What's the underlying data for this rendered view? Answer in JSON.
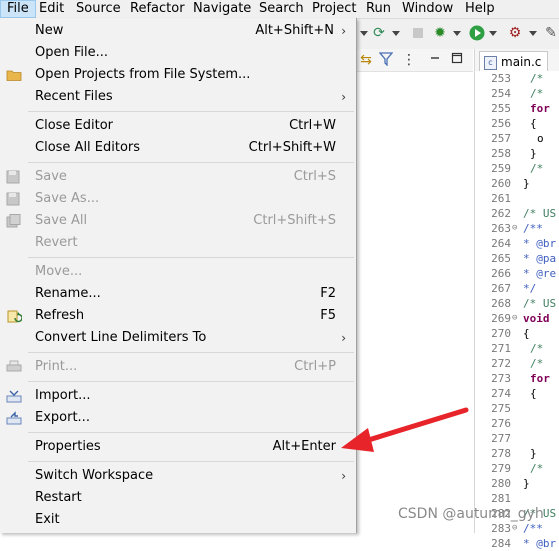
{
  "menubar": {
    "items": [
      "File",
      "Edit",
      "Source",
      "Refactor",
      "Navigate",
      "Search",
      "Project",
      "Run",
      "Window",
      "Help"
    ]
  },
  "file_menu": {
    "new": {
      "label": "New",
      "accel": "Alt+Shift+N"
    },
    "open_file": {
      "label": "Open File..."
    },
    "open_projects": {
      "label": "Open Projects from File System..."
    },
    "recent_files": {
      "label": "Recent Files"
    },
    "close_editor": {
      "label": "Close Editor",
      "accel": "Ctrl+W"
    },
    "close_all": {
      "label": "Close All Editors",
      "accel": "Ctrl+Shift+W"
    },
    "save": {
      "label": "Save",
      "accel": "Ctrl+S"
    },
    "save_as": {
      "label": "Save As..."
    },
    "save_all": {
      "label": "Save All",
      "accel": "Ctrl+Shift+S"
    },
    "revert": {
      "label": "Revert"
    },
    "move": {
      "label": "Move..."
    },
    "rename": {
      "label": "Rename...",
      "accel": "F2"
    },
    "refresh": {
      "label": "Refresh",
      "accel": "F5"
    },
    "convert": {
      "label": "Convert Line Delimiters To"
    },
    "print": {
      "label": "Print...",
      "accel": "Ctrl+P"
    },
    "import": {
      "label": "Import..."
    },
    "export": {
      "label": "Export..."
    },
    "properties": {
      "label": "Properties",
      "accel": "Alt+Enter"
    },
    "switch_ws": {
      "label": "Switch Workspace"
    },
    "restart": {
      "label": "Restart"
    },
    "exit": {
      "label": "Exit"
    }
  },
  "editor": {
    "tab_label": "main.c",
    "tab_icon_letter": "c",
    "lines": [
      {
        "n": "253",
        "text": "/*",
        "cls": "comment",
        "indent": 2,
        "fold": ""
      },
      {
        "n": "254",
        "text": "/*",
        "cls": "comment",
        "indent": 2,
        "fold": ""
      },
      {
        "n": "255",
        "text": "for",
        "cls": "kw",
        "indent": 2,
        "fold": ""
      },
      {
        "n": "256",
        "text": "{",
        "cls": "plain",
        "indent": 2,
        "fold": ""
      },
      {
        "n": "257",
        "text": "o",
        "cls": "plain",
        "indent": 4,
        "fold": ""
      },
      {
        "n": "258",
        "text": "}",
        "cls": "plain",
        "indent": 2,
        "fold": ""
      },
      {
        "n": "259",
        "text": "/*",
        "cls": "comment",
        "indent": 2,
        "fold": ""
      },
      {
        "n": "260",
        "text": "}",
        "cls": "plain",
        "indent": 0,
        "fold": ""
      },
      {
        "n": "261",
        "text": "",
        "cls": "plain",
        "indent": 0,
        "fold": ""
      },
      {
        "n": "262",
        "text": "/* US",
        "cls": "comment",
        "indent": 0,
        "fold": ""
      },
      {
        "n": "263",
        "text": "/**",
        "cls": "doc",
        "indent": 0,
        "fold": "⊖"
      },
      {
        "n": "264",
        "text": "* @br",
        "cls": "doc",
        "indent": 0,
        "fold": ""
      },
      {
        "n": "265",
        "text": "* @pa",
        "cls": "doc",
        "indent": 0,
        "fold": ""
      },
      {
        "n": "266",
        "text": "* @re",
        "cls": "doc",
        "indent": 0,
        "fold": ""
      },
      {
        "n": "267",
        "text": "*/",
        "cls": "doc",
        "indent": 0,
        "fold": ""
      },
      {
        "n": "268",
        "text": "/* US",
        "cls": "comment",
        "indent": 0,
        "fold": ""
      },
      {
        "n": "269",
        "text": "void",
        "cls": "kw",
        "indent": 0,
        "fold": "⊖"
      },
      {
        "n": "270",
        "text": "{",
        "cls": "plain",
        "indent": 0,
        "fold": ""
      },
      {
        "n": "271",
        "text": "/*",
        "cls": "comment",
        "indent": 2,
        "fold": ""
      },
      {
        "n": "272",
        "text": "/*",
        "cls": "comment",
        "indent": 2,
        "fold": ""
      },
      {
        "n": "273",
        "text": "for",
        "cls": "kw",
        "indent": 2,
        "fold": ""
      },
      {
        "n": "274",
        "text": "{",
        "cls": "plain",
        "indent": 2,
        "fold": ""
      },
      {
        "n": "275",
        "text": "",
        "cls": "plain",
        "indent": 0,
        "fold": ""
      },
      {
        "n": "276",
        "text": "",
        "cls": "plain",
        "indent": 0,
        "fold": ""
      },
      {
        "n": "277",
        "text": "",
        "cls": "plain",
        "indent": 0,
        "fold": ""
      },
      {
        "n": "278",
        "text": "}",
        "cls": "plain",
        "indent": 2,
        "fold": ""
      },
      {
        "n": "279",
        "text": "/*",
        "cls": "comment",
        "indent": 2,
        "fold": ""
      },
      {
        "n": "280",
        "text": "}",
        "cls": "plain",
        "indent": 0,
        "fold": ""
      },
      {
        "n": "281",
        "text": "",
        "cls": "plain",
        "indent": 0,
        "fold": ""
      },
      {
        "n": "282",
        "text": "/* US",
        "cls": "comment",
        "indent": 0,
        "fold": ""
      },
      {
        "n": "283",
        "text": "/**",
        "cls": "doc",
        "indent": 0,
        "fold": "⊖"
      },
      {
        "n": "284",
        "text": "* @br",
        "cls": "doc",
        "indent": 0,
        "fold": ""
      }
    ]
  },
  "watermark": "CSDN @autumn_gyh",
  "colors": {
    "menu_bg": "#f2f2f2",
    "arrow": "#e8242b",
    "active_menu": "#cce4f7"
  }
}
